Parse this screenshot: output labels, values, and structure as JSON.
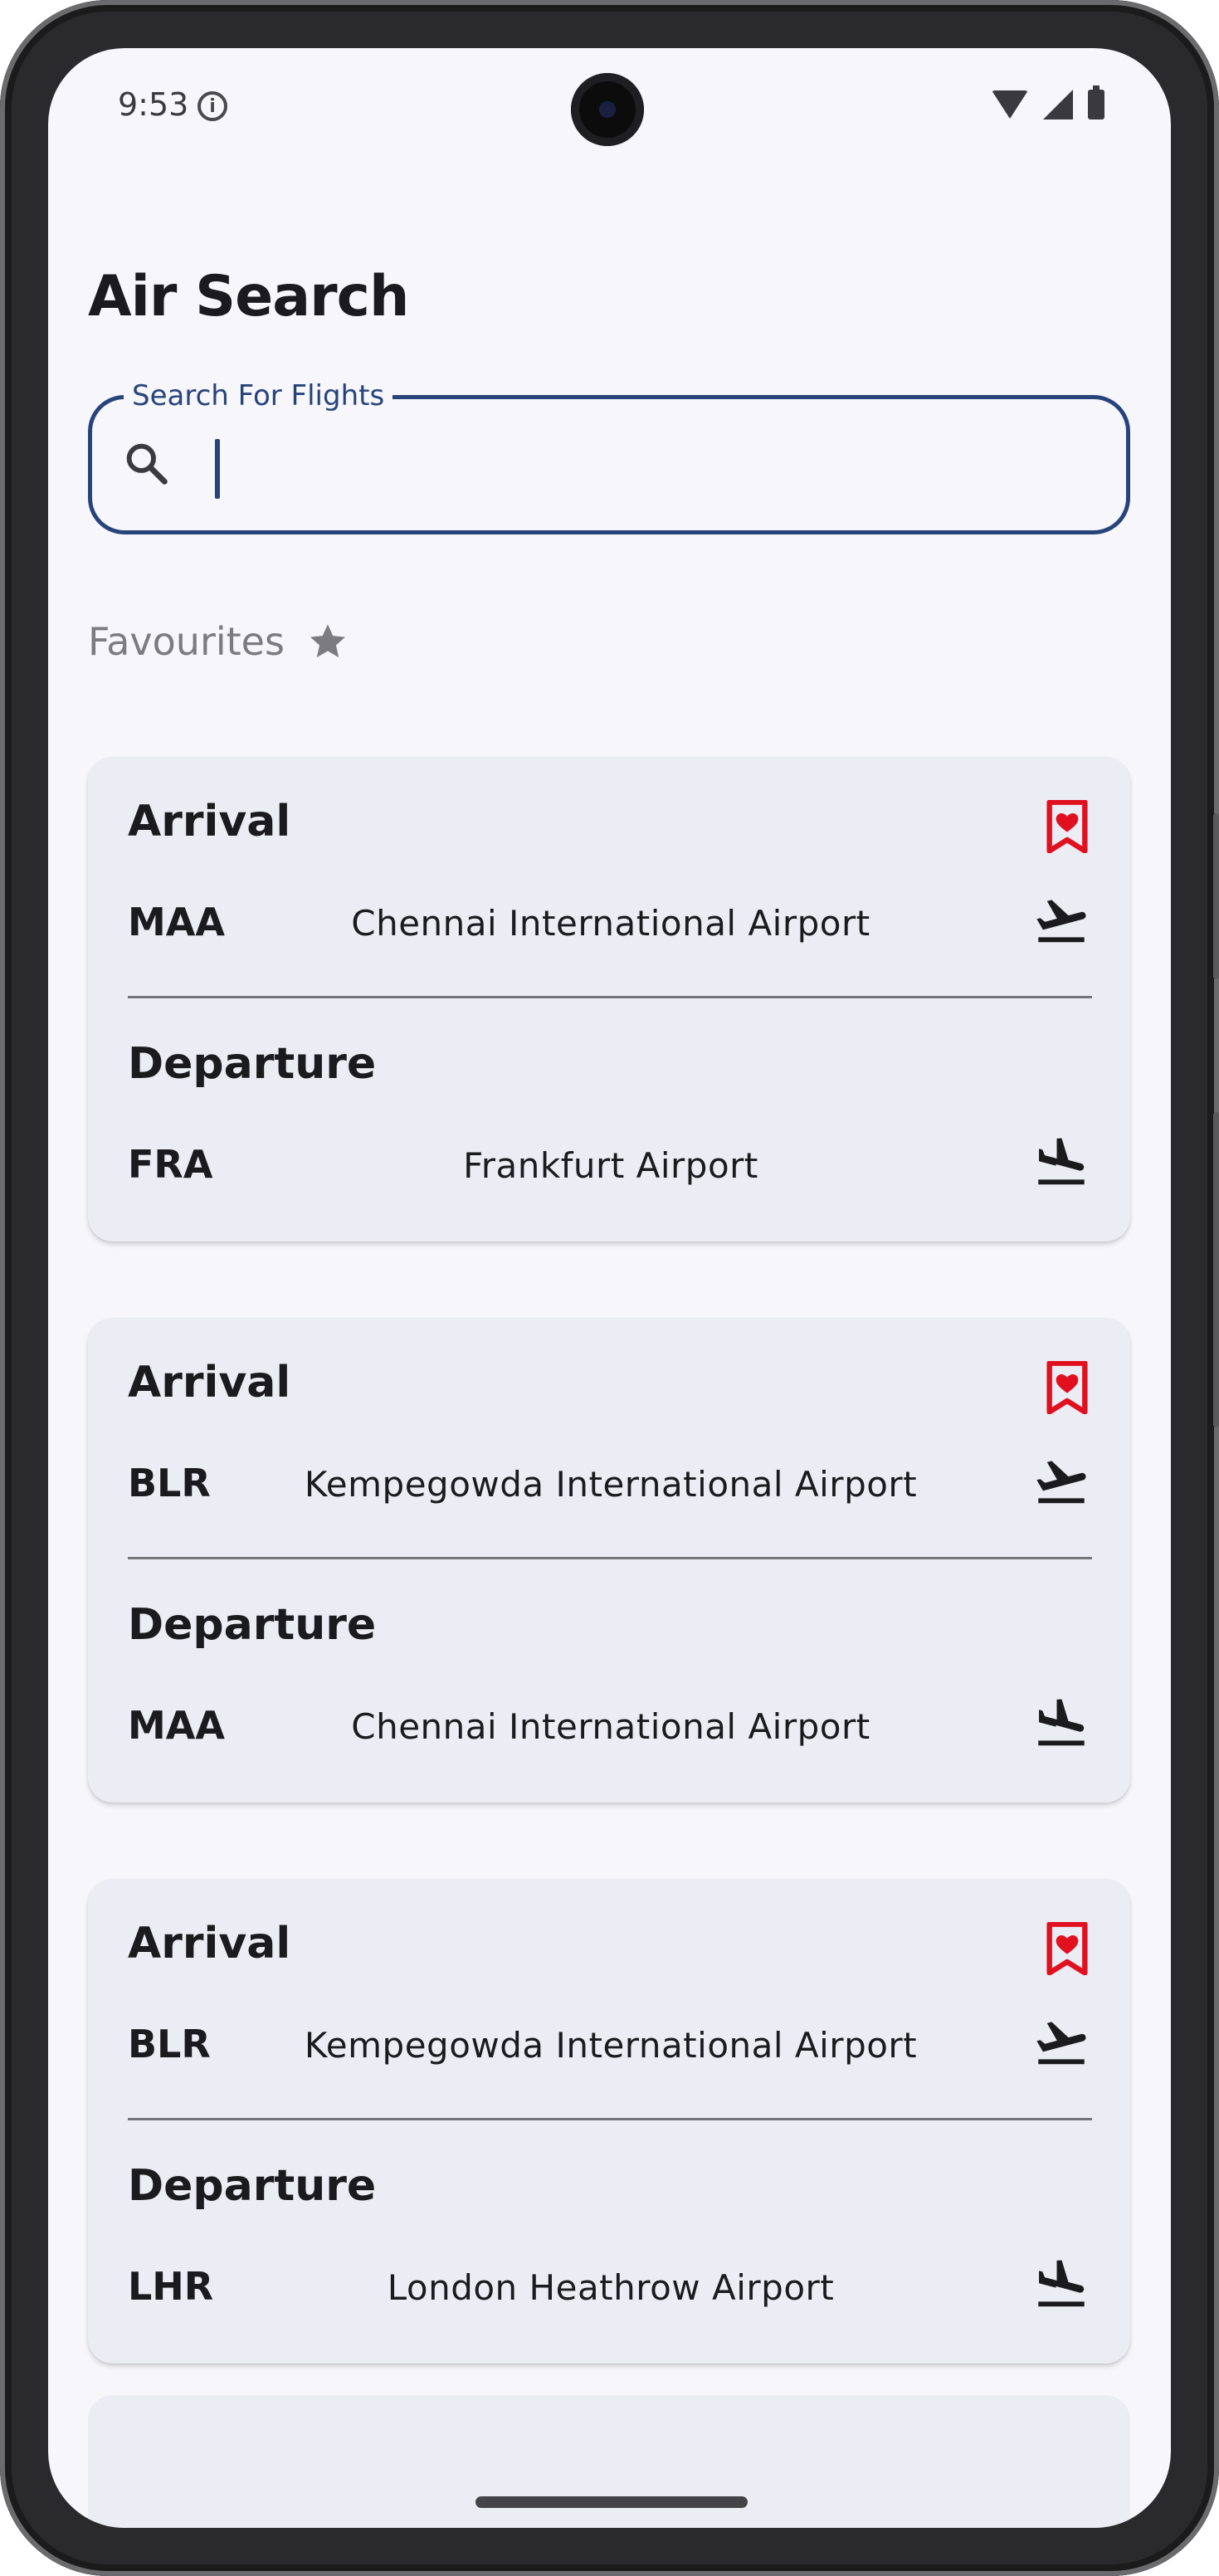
{
  "status_bar": {
    "time": "9:53"
  },
  "header": {
    "title": "Air Search"
  },
  "search": {
    "label": "Search For Flights",
    "value": "",
    "placeholder": ""
  },
  "favourites": {
    "label": "Favourites"
  },
  "colors": {
    "accent": "#27447a",
    "favorite_red": "#e0101f",
    "card_bg": "#ececf4",
    "screen_bg": "#f6f6fb"
  },
  "cards": [
    {
      "arrival_label": "Arrival",
      "arrival_code": "MAA",
      "arrival_airport": "Chennai International Airport",
      "departure_label": "Departure",
      "departure_code": "FRA",
      "departure_airport": "Frankfurt Airport"
    },
    {
      "arrival_label": "Arrival",
      "arrival_code": "BLR",
      "arrival_airport": "Kempegowda International Airport",
      "departure_label": "Departure",
      "departure_code": "MAA",
      "departure_airport": "Chennai International Airport"
    },
    {
      "arrival_label": "Arrival",
      "arrival_code": "BLR",
      "arrival_airport": "Kempegowda International Airport",
      "departure_label": "Departure",
      "departure_code": "LHR",
      "departure_airport": "London Heathrow Airport"
    }
  ],
  "icons": {
    "search": "search-icon",
    "star": "star-icon",
    "favorite": "favorite-bookmark-icon",
    "takeoff": "flight-takeoff-icon",
    "landing": "flight-land-icon"
  }
}
